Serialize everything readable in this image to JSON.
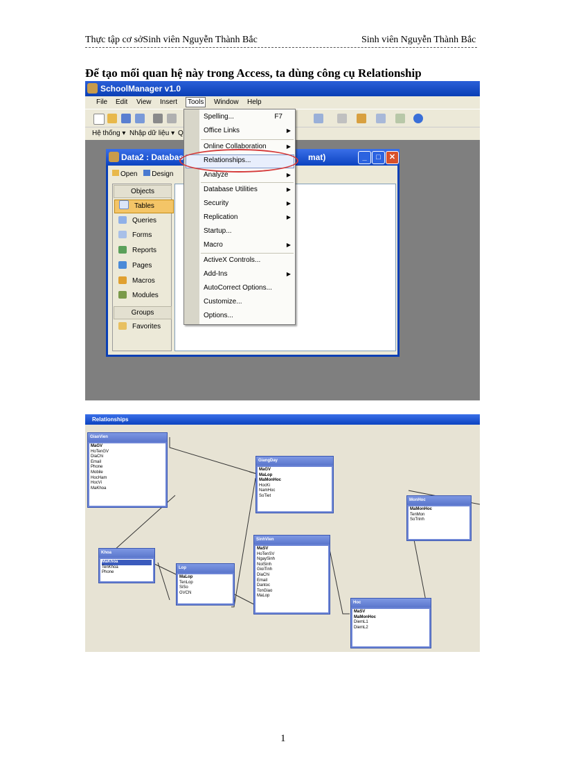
{
  "header": {
    "left": "Thực tập cơ sởSinh viên Nguyễn Thành Bắc",
    "right": "Sinh viên Nguyễn Thành Bắc"
  },
  "heading": "Để tạo mối quan hệ này trong Access, ta dùng công cụ Relationship",
  "page_number": "1",
  "shot1": {
    "app_title": "SchoolManager v1.0",
    "menubar": [
      "File",
      "Edit",
      "View",
      "Insert",
      "Tools",
      "Window",
      "Help"
    ],
    "toolbar2": [
      "Hệ thống ▾",
      "Nhập dữ liệu ▾",
      "Q"
    ],
    "db_window": {
      "title_left": "Data2 : Database",
      "title_right": "mat)",
      "open_label": "Open",
      "design_label": "Design",
      "objects_header": "Objects",
      "objects": [
        "Tables",
        "Queries",
        "Forms",
        "Reports",
        "Pages",
        "Macros",
        "Modules"
      ],
      "groups_header": "Groups",
      "groups": [
        "Favorites"
      ]
    },
    "tools_menu": [
      {
        "label": "Spelling...",
        "key": "F7"
      },
      {
        "label": "Office Links",
        "submenu": true
      },
      {
        "label": "Online Collaboration",
        "submenu": true
      },
      {
        "label": "Relationships...",
        "highlighted": true
      },
      {
        "label": "Analyze",
        "submenu": true
      },
      {
        "label": "Database Utilities",
        "submenu": true
      },
      {
        "label": "Security",
        "submenu": true
      },
      {
        "label": "Replication",
        "submenu": true
      },
      {
        "label": "Startup..."
      },
      {
        "label": "Macro",
        "submenu": true
      },
      {
        "label": "ActiveX Controls..."
      },
      {
        "label": "Add-Ins",
        "submenu": true
      },
      {
        "label": "AutoCorrect Options..."
      },
      {
        "label": "Customize..."
      },
      {
        "label": "Options..."
      }
    ],
    "colors": {
      "titlebar": "#0a3fb5",
      "menu_bg": "#ece9d8",
      "highlight_oval": "#d53a3a",
      "selected_object": "#f4c567"
    }
  },
  "shot2": {
    "title": "Relationships",
    "tables": {
      "giaovien": {
        "name": "GiaoVien",
        "fields": [
          "MaGV",
          "HoTenGV",
          "DiaChi",
          "Email",
          "Phone",
          "Mobile",
          "HocHam",
          "HocVi",
          "MaKhoa"
        ]
      },
      "giangday": {
        "name": "GiangDay",
        "fields": [
          "MaGV",
          "MaLop",
          "MaMonHoc",
          "HocKi",
          "NamHoc",
          "SoTiet"
        ]
      },
      "monhoc": {
        "name": "MonHoc",
        "fields": [
          "MaMonHoc",
          "TenMon",
          "SoTrinh"
        ]
      },
      "khoa": {
        "name": "Khoa",
        "fields": [
          "MaKhoa",
          "TenKhoa",
          "Phone"
        ]
      },
      "lop": {
        "name": "Lop",
        "fields": [
          "MaLop",
          "TenLop",
          "SiSo",
          "GVCN"
        ]
      },
      "sinhvien": {
        "name": "SinhVien",
        "fields": [
          "MaSV",
          "HoTenSV",
          "NgaySinh",
          "NoiSinh",
          "GioiTinh",
          "DiaChi",
          "Email",
          "Dantoc",
          "TonGiao",
          "MaLop"
        ]
      },
      "hoc": {
        "name": "Hoc",
        "fields": [
          "MaSV",
          "MaMonHoc",
          "DiemL1",
          "DiemL2"
        ]
      }
    }
  }
}
